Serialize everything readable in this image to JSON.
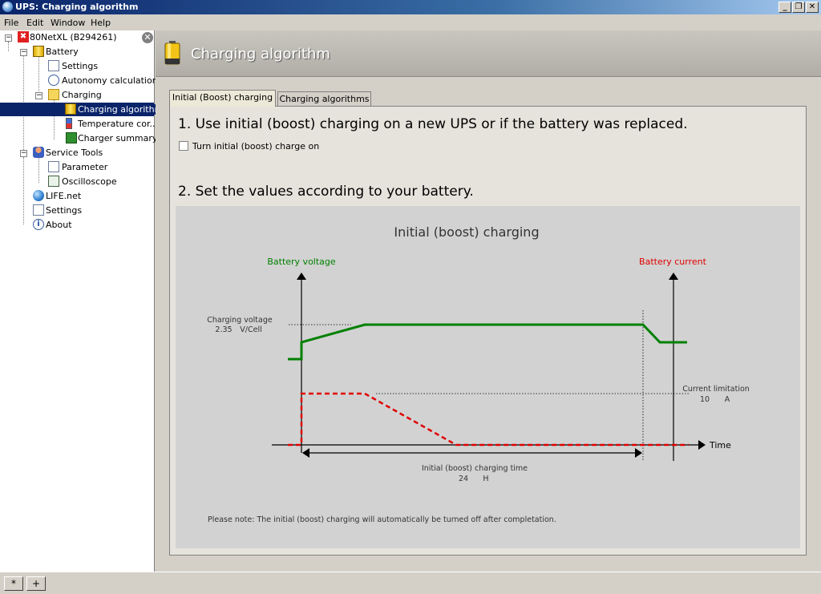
{
  "window": {
    "title": "UPS: Charging algorithm"
  },
  "menu": [
    "File",
    "Edit",
    "Window",
    "Help"
  ],
  "tree": {
    "root": "80NetXL (B294261)",
    "battery": "Battery",
    "settings": "Settings",
    "autonomy": "Autonomy calculation",
    "charging": "Charging",
    "charging_algorithm": "Charging algorithm",
    "temperature": "Temperature cor...",
    "charger_summary": "Charger summary",
    "service_tools": "Service Tools",
    "parameter": "Parameter",
    "oscilloscope": "Oscilloscope",
    "life_net": "LIFE.net",
    "settings2": "Settings",
    "about": "About"
  },
  "header": {
    "title": "Charging algorithm"
  },
  "tabs": {
    "tab1": "Initial (Boost) charging",
    "tab2": "Charging algorithms"
  },
  "content": {
    "step1": "1. Use initial (boost) charging on a new UPS or if the battery was replaced.",
    "checkbox_label": "Turn initial (boost) charge on",
    "checkbox_checked": false,
    "step2": "2. Set the values according to your battery."
  },
  "chart_data": {
    "type": "line",
    "title": "Initial (boost) charging",
    "left_axis_label": "Battery voltage",
    "right_axis_label": "Battery current",
    "x_axis_label": "Time",
    "charging_voltage_label": "Charging voltage",
    "charging_voltage_value": "2.35",
    "charging_voltage_unit": "V/Cell",
    "current_limitation_label": "Current limitation",
    "current_limitation_value": "10",
    "current_limitation_unit": "A",
    "charging_time_label": "Initial (boost) charging time",
    "charging_time_value": "24",
    "charging_time_unit": "H",
    "note": "Please note: The initial (boost) charging will automatically be turned off after completation.",
    "colors": {
      "voltage": "#008000",
      "current": "#e00000",
      "axis": "#000000"
    }
  },
  "statusbar": {
    "btn_star": "*",
    "btn_plus": "+"
  }
}
